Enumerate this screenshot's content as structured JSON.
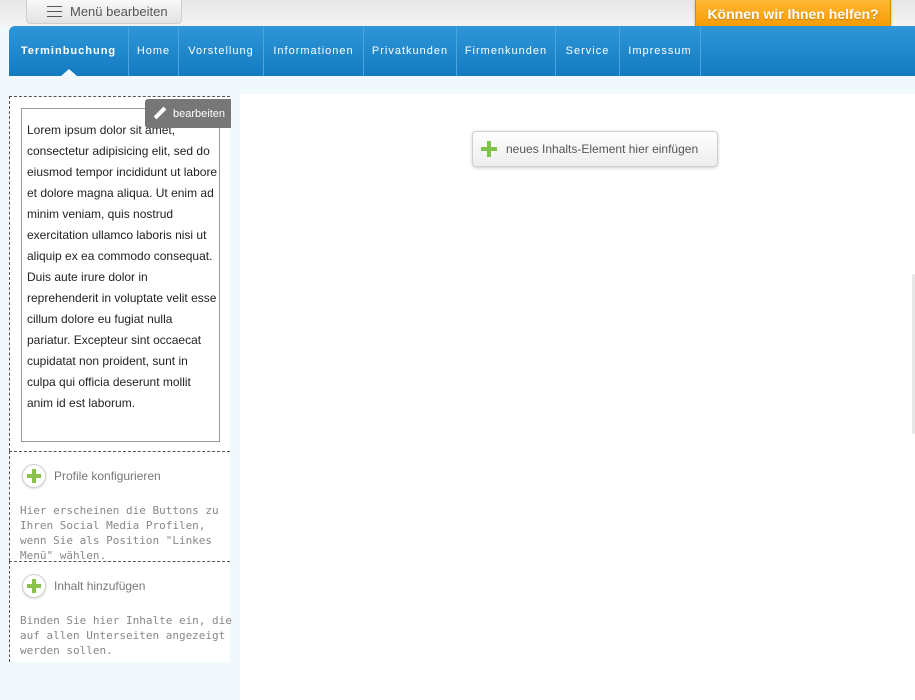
{
  "topbar": {
    "menu_edit_label": "Menü bearbeiten",
    "help_label": "Können wir Ihnen helfen?"
  },
  "nav": {
    "items": [
      {
        "label": "Terminbuchung",
        "active": true
      },
      {
        "label": "Home"
      },
      {
        "label": "Vorstellung"
      },
      {
        "label": "Informationen"
      },
      {
        "label": "Privatkunden"
      },
      {
        "label": "Firmenkunden"
      },
      {
        "label": "Service"
      },
      {
        "label": "Impressum"
      }
    ]
  },
  "sidebar": {
    "edit_label": "bearbeiten",
    "lorem_text": "Lorem ipsum dolor sit amet, consectetur adipisicing elit, sed do eiusmod tempor incididunt ut labore et dolore magna aliqua. Ut enim ad minim veniam, quis nostrud exercitation ullamco laboris nisi ut aliquip ex ea commodo consequat. Duis aute irure dolor in reprehenderit in voluptate velit esse cillum dolore eu fugiat nulla pariatur. Excepteur sint occaecat cupidatat non proident, sunt in culpa qui officia deserunt mollit anim id est laborum.",
    "profiles": {
      "title": "Profile konfigurieren",
      "description": "Hier erscheinen die Buttons zu Ihren Social Media Profilen, wenn Sie als Position \"Linkes Menü\" wählen."
    },
    "content": {
      "title": "Inhalt hinzufügen",
      "description": "Binden Sie hier Inhalte ein, die auf allen Unterseiten angezeigt werden sollen."
    }
  },
  "main": {
    "add_element_label": "neues Inhalts-Element hier einfügen"
  },
  "colors": {
    "nav_blue": "#1a86cc",
    "help_orange": "#f7a21b",
    "plus_green": "#7fc24a"
  }
}
